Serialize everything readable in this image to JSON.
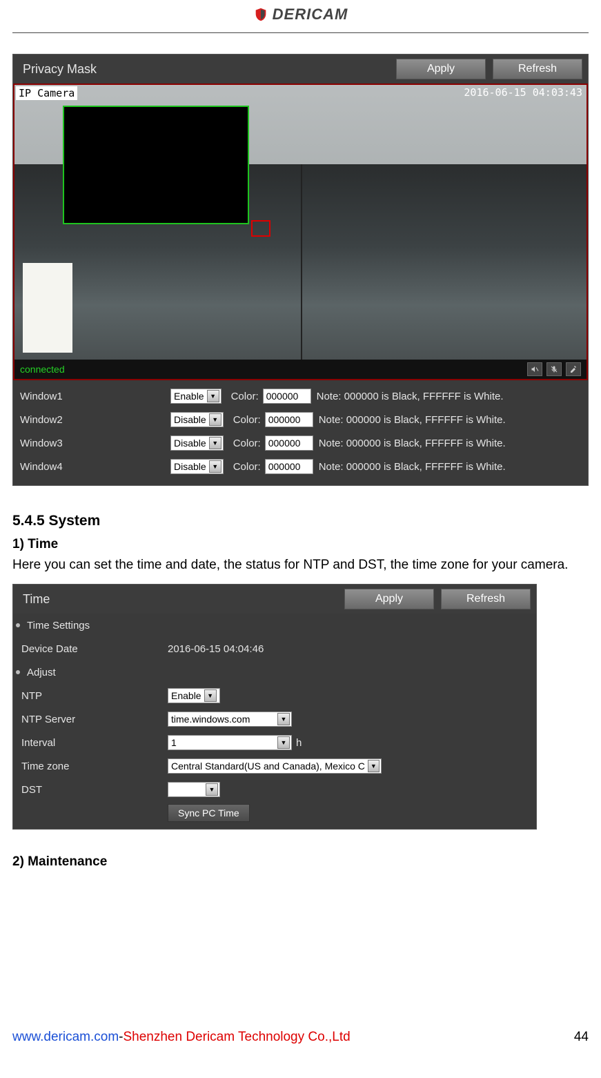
{
  "header": {
    "brand": "DERICAM"
  },
  "privacy": {
    "title": "Privacy Mask",
    "apply": "Apply",
    "refresh": "Refresh",
    "ip_label": "IP Camera",
    "timestamp": "2016-06-15 04:03:43",
    "status": "connected",
    "color_label": "Color:",
    "note": "Note: 000000 is Black, FFFFFF is White.",
    "windows": [
      {
        "name": "Window1",
        "state": "Enable",
        "color": "000000"
      },
      {
        "name": "Window2",
        "state": "Disable",
        "color": "000000"
      },
      {
        "name": "Window3",
        "state": "Disable",
        "color": "000000"
      },
      {
        "name": "Window4",
        "state": "Disable",
        "color": "000000"
      }
    ]
  },
  "doc": {
    "h_system": "5.4.5 System",
    "h_time": "1) Time",
    "p_time": "Here you can set the time and date, the status for NTP and DST, the time zone for your camera.",
    "h_maint": "2) Maintenance"
  },
  "time": {
    "title": "Time",
    "apply": "Apply",
    "refresh": "Refresh",
    "sub_settings": "Time Settings",
    "l_device_date": "Device Date",
    "device_date": "2016-06-15 04:04:46",
    "sub_adjust": "Adjust",
    "l_ntp": "NTP",
    "ntp": "Enable",
    "l_ntp_server": "NTP Server",
    "ntp_server": "time.windows.com",
    "l_interval": "Interval",
    "interval": "1",
    "interval_unit": "h",
    "l_tz": "Time zone",
    "tz": "Central Standard(US and Canada), Mexico City",
    "l_dst": "DST",
    "dst": "",
    "sync": "Sync PC Time"
  },
  "footer": {
    "url": "www.dericam.com",
    "sep": "-",
    "company": "Shenzhen Dericam Technology Co.,Ltd",
    "page": "44"
  }
}
